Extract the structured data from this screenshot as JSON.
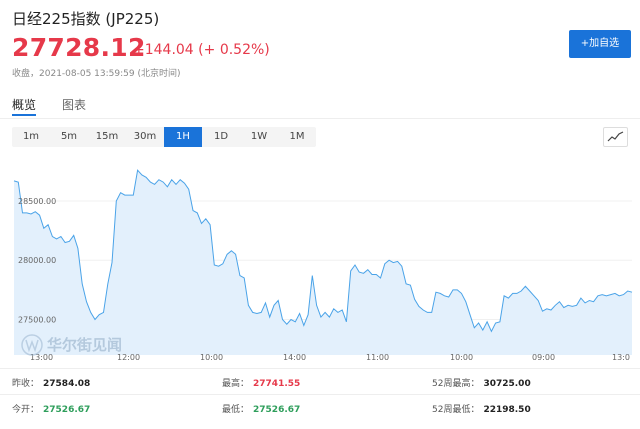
{
  "header": {
    "title": "日经225指数",
    "code": "(JP225)",
    "price": "27728.12",
    "change": "+144.04",
    "change_pct": "(+ 0.52%)",
    "status_label": "收盘，",
    "timestamp": "2021-08-05 13:59:59",
    "timezone": "(北京时间)",
    "add_button": "+加自选"
  },
  "tabs": [
    {
      "label": "概览",
      "active": true
    },
    {
      "label": "图表",
      "active": false
    }
  ],
  "periods": [
    {
      "label": "1m",
      "active": false
    },
    {
      "label": "5m",
      "active": false
    },
    {
      "label": "15m",
      "active": false
    },
    {
      "label": "30m",
      "active": false
    },
    {
      "label": "1H",
      "active": true
    },
    {
      "label": "1D",
      "active": false
    },
    {
      "label": "1W",
      "active": false
    },
    {
      "label": "1M",
      "active": false
    }
  ],
  "chart_toggle_icon": "line-chart-icon",
  "watermark": "华尔街见闻",
  "chart_data": {
    "type": "area",
    "ytick_labels": [
      "28500.00",
      "28000.00",
      "27500.00"
    ],
    "yticks": [
      28500,
      28000,
      27500
    ],
    "ylim": [
      27200,
      28880
    ],
    "xtick_labels": [
      "13:00",
      "12:00",
      "10:00",
      "14:00",
      "11:00",
      "10:00",
      "09:00",
      "13:0"
    ],
    "line_color": "#4aa3e8",
    "fill_color": "#e3f0fc",
    "values": [
      28670,
      28660,
      28400,
      28400,
      28390,
      28410,
      28380,
      28270,
      28300,
      28200,
      28180,
      28200,
      28150,
      28160,
      28210,
      28100,
      27800,
      27650,
      27560,
      27500,
      27540,
      27560,
      27800,
      27980,
      28500,
      28570,
      28550,
      28550,
      28550,
      28760,
      28720,
      28700,
      28660,
      28640,
      28680,
      28660,
      28620,
      28680,
      28640,
      28680,
      28650,
      28600,
      28420,
      28400,
      28310,
      28350,
      28300,
      27960,
      27950,
      27970,
      28050,
      28080,
      28050,
      27870,
      27850,
      27620,
      27560,
      27550,
      27560,
      27640,
      27520,
      27620,
      27660,
      27500,
      27460,
      27500,
      27480,
      27550,
      27450,
      27540,
      27870,
      27620,
      27520,
      27560,
      27520,
      27590,
      27560,
      27580,
      27480,
      27910,
      27960,
      27900,
      27890,
      27920,
      27880,
      27880,
      27850,
      27970,
      28000,
      27980,
      27990,
      27950,
      27800,
      27790,
      27670,
      27610,
      27580,
      27560,
      27560,
      27730,
      27720,
      27700,
      27690,
      27750,
      27750,
      27720,
      27650,
      27540,
      27430,
      27470,
      27410,
      27480,
      27400,
      27470,
      27480,
      27700,
      27680,
      27720,
      27720,
      27740,
      27780,
      27740,
      27700,
      27660,
      27570,
      27590,
      27580,
      27620,
      27650,
      27600,
      27620,
      27610,
      27620,
      27680,
      27640,
      27660,
      27650,
      27700,
      27710,
      27700,
      27710,
      27720,
      27700,
      27710,
      27740,
      27730
    ]
  },
  "stats": [
    [
      {
        "label": "昨收：",
        "value": "27584.08",
        "tone": "neutral"
      },
      {
        "label": "最高：",
        "value": "27741.55",
        "tone": "up"
      },
      {
        "label": "52周最高：",
        "value": "30725.00",
        "tone": "neutral"
      }
    ],
    [
      {
        "label": "今开：",
        "value": "27526.67",
        "tone": "down"
      },
      {
        "label": "最低：",
        "value": "27526.67",
        "tone": "down"
      },
      {
        "label": "52周最低：",
        "value": "22198.50",
        "tone": "neutral"
      }
    ]
  ]
}
